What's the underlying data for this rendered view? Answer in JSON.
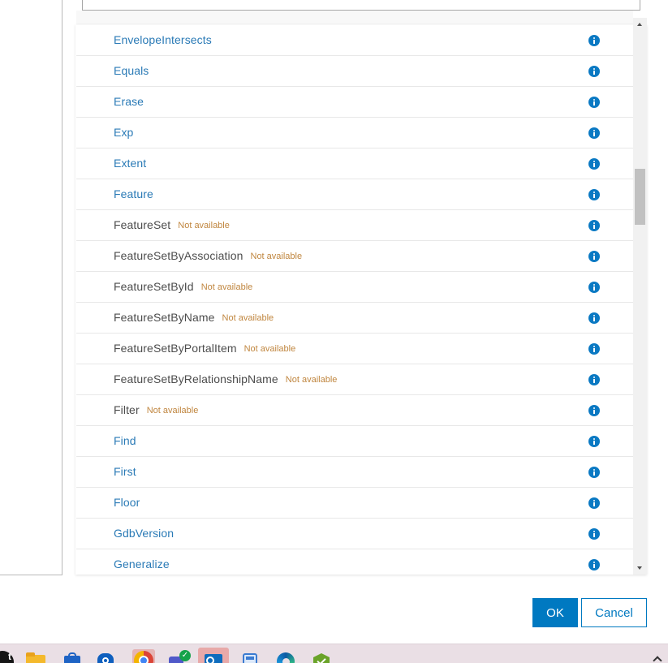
{
  "search": {
    "value": "",
    "placeholder": ""
  },
  "functions": [
    {
      "name": "EnvelopeIntersects",
      "available": true
    },
    {
      "name": "Equals",
      "available": true
    },
    {
      "name": "Erase",
      "available": true
    },
    {
      "name": "Exp",
      "available": true
    },
    {
      "name": "Extent",
      "available": true
    },
    {
      "name": "Feature",
      "available": true
    },
    {
      "name": "FeatureSet",
      "available": false
    },
    {
      "name": "FeatureSetByAssociation",
      "available": false
    },
    {
      "name": "FeatureSetById",
      "available": false
    },
    {
      "name": "FeatureSetByName",
      "available": false
    },
    {
      "name": "FeatureSetByPortalItem",
      "available": false
    },
    {
      "name": "FeatureSetByRelationshipName",
      "available": false
    },
    {
      "name": "Filter",
      "available": false
    },
    {
      "name": "Find",
      "available": true
    },
    {
      "name": "First",
      "available": true
    },
    {
      "name": "Floor",
      "available": true
    },
    {
      "name": "GdbVersion",
      "available": true
    },
    {
      "name": "Generalize",
      "available": true
    }
  ],
  "labels": {
    "not_available": "Not available"
  },
  "list_scroll_fraction": 0.3,
  "buttons": {
    "ok": "OK",
    "cancel": "Cancel"
  },
  "taskbar": {
    "start_glyph": "t",
    "teams_status_glyph": "✓",
    "icons": [
      "start-icon",
      "file-explorer-icon",
      "store-icon",
      "shield-icon",
      "chrome-icon",
      "teams-icon",
      "outlook-icon",
      "calculator-icon",
      "edge-icon",
      "green-app-icon",
      "tray-chevron-icon"
    ]
  },
  "colors": {
    "accent": "#0079c1",
    "link": "#2a7ab6",
    "unavailable_text": "#4c4c4c",
    "badge": "#c0863f",
    "info_icon": "#0a79c3",
    "taskbar": "#eadfe5"
  }
}
